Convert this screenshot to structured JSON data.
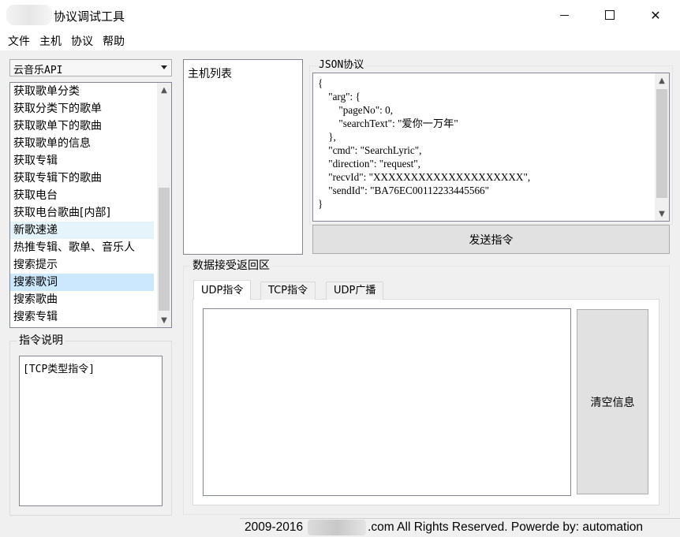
{
  "window": {
    "title": "协议调试工具",
    "controls": {
      "minimize": "",
      "maximize": "",
      "close": "✕"
    }
  },
  "menu": [
    "文件",
    "主机",
    "协议",
    "帮助"
  ],
  "api_combo": {
    "selected": "云音乐API"
  },
  "command_list": {
    "items": [
      "获取歌单分类",
      "获取分类下的歌单",
      "获取歌单下的歌曲",
      "获取歌单的信息",
      "获取专辑",
      "获取专辑下的歌曲",
      "获取电台",
      "获取电台歌曲[内部]",
      "新歌速递",
      "热推专辑、歌单、音乐人",
      "搜索提示",
      "搜索歌词",
      "搜索歌曲",
      "搜索专辑"
    ],
    "hovered_index": 8,
    "selected_index": 11
  },
  "instruction_desc": {
    "label": "指令说明",
    "text": "[TCP类型指令]"
  },
  "host_list": {
    "label": "主机列表"
  },
  "json_protocol": {
    "label": "JSON协议",
    "lines": [
      "{",
      "    \"arg\": {",
      "        \"pageNo\": 0,",
      "        \"searchText\": \"爱你一万年\"",
      "    },",
      "    \"cmd\": \"SearchLyric\",",
      "    \"direction\": \"request\",",
      "    \"recvId\": \"XXXXXXXXXXXXXXXXXXXX\",",
      "    \"sendId\": \"BA76EC00112233445566\"",
      "}"
    ]
  },
  "send_button": "发送指令",
  "receive_area": {
    "label": "数据接受返回区",
    "tabs": [
      "UDP指令",
      "TCP指令",
      "UDP广播"
    ],
    "active_tab": 0,
    "clear_button": "清空信息"
  },
  "status_bar": {
    "prefix": "2009-2016",
    "suffix": ".com All Rights Reserved. Powerde by:  automation"
  }
}
